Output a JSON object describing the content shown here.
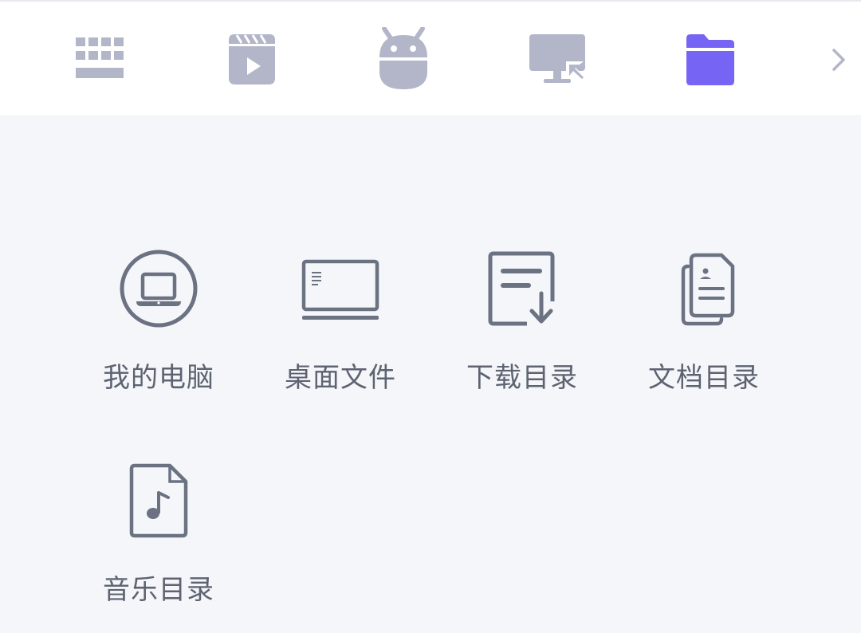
{
  "tabs": [
    {
      "name": "keyboard",
      "icon": "keyboard-icon",
      "active": false
    },
    {
      "name": "video",
      "icon": "video-clapper-icon",
      "active": false
    },
    {
      "name": "android",
      "icon": "android-icon",
      "active": false
    },
    {
      "name": "screen",
      "icon": "remote-screen-icon",
      "active": false
    },
    {
      "name": "files",
      "icon": "folder-icon",
      "active": true
    }
  ],
  "colors": {
    "icon_inactive": "#b2b6c8",
    "icon_active": "#7664f5",
    "item_icon": "#6b7282",
    "label": "#5d6371",
    "background": "#f5f6fa",
    "tabbar_bg": "#ffffff"
  },
  "folders": [
    {
      "label": "我的电脑",
      "icon": "laptop-circle-icon"
    },
    {
      "label": "桌面文件",
      "icon": "desktop-monitor-icon"
    },
    {
      "label": "下载目录",
      "icon": "download-document-icon"
    },
    {
      "label": "文档目录",
      "icon": "documents-stack-icon"
    },
    {
      "label": "音乐目录",
      "icon": "music-file-icon"
    }
  ]
}
